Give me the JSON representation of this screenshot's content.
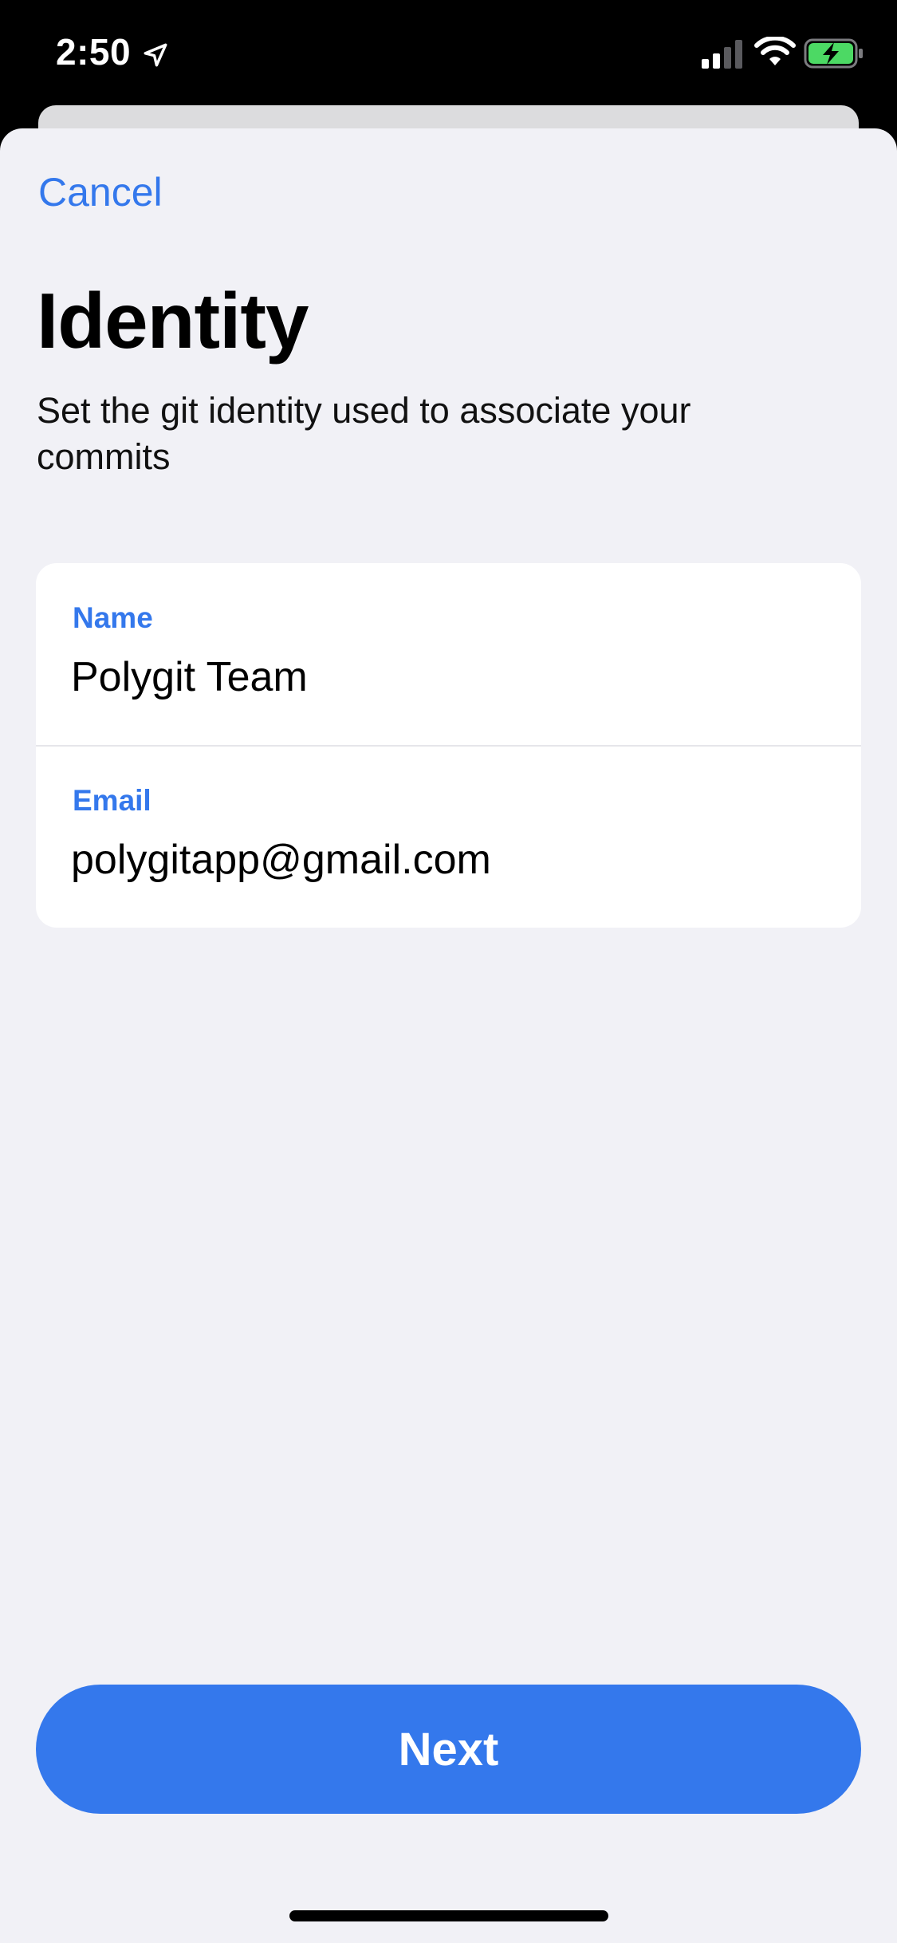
{
  "status_bar": {
    "time": "2:50",
    "icons": [
      "location-arrow-icon",
      "cellular-signal-icon",
      "wifi-icon",
      "battery-charging-icon"
    ],
    "battery_color": "#4cd964"
  },
  "nav": {
    "cancel_label": "Cancel"
  },
  "header": {
    "title": "Identity",
    "subtitle": "Set the git identity used to associate your commits"
  },
  "form": {
    "name_label": "Name",
    "name_value": "Polygit Team",
    "email_label": "Email",
    "email_value": "polygitapp@gmail.com"
  },
  "actions": {
    "next_label": "Next"
  },
  "colors": {
    "accent": "#3478ec",
    "background": "#f1f1f6",
    "card": "#ffffff"
  }
}
